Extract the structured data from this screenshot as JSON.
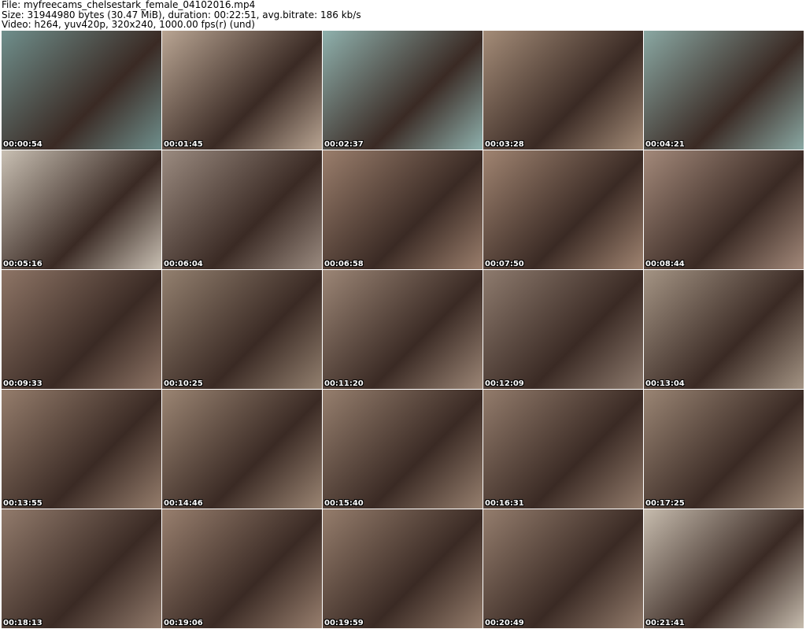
{
  "header": {
    "file": "File: myfreecams_chelsestark_female_04102016.mp4",
    "size": "Size: 31944980 bytes (30.47 MiB), duration: 00:22:51, avg.bitrate: 186 kb/s",
    "video": "Video: h264, yuv420p, 320x240, 1000.00 fps(r) (und)"
  },
  "thumbnails": [
    {
      "time": "00:00:54",
      "tone": "#6f8f8c"
    },
    {
      "time": "00:01:45",
      "tone": "#b9a593"
    },
    {
      "time": "00:02:37",
      "tone": "#8fb1ad"
    },
    {
      "time": "00:03:28",
      "tone": "#a48c78"
    },
    {
      "time": "00:04:21",
      "tone": "#8aa8a3"
    },
    {
      "time": "00:05:16",
      "tone": "#c9c0b3"
    },
    {
      "time": "00:06:04",
      "tone": "#9b8b80"
    },
    {
      "time": "00:06:58",
      "tone": "#9a7e6c"
    },
    {
      "time": "00:07:50",
      "tone": "#a08471"
    },
    {
      "time": "00:08:44",
      "tone": "#a3897a"
    },
    {
      "time": "00:09:33",
      "tone": "#8e7566"
    },
    {
      "time": "00:10:25",
      "tone": "#93806f"
    },
    {
      "time": "00:11:20",
      "tone": "#9c8676"
    },
    {
      "time": "00:12:09",
      "tone": "#8e7b6e"
    },
    {
      "time": "00:13:04",
      "tone": "#a49484"
    },
    {
      "time": "00:13:55",
      "tone": "#957d6c"
    },
    {
      "time": "00:14:46",
      "tone": "#9b8573"
    },
    {
      "time": "00:15:40",
      "tone": "#967f6e"
    },
    {
      "time": "00:16:31",
      "tone": "#937c6c"
    },
    {
      "time": "00:17:25",
      "tone": "#9a8574"
    },
    {
      "time": "00:18:13",
      "tone": "#927b6c"
    },
    {
      "time": "00:19:06",
      "tone": "#987f6e"
    },
    {
      "time": "00:19:59",
      "tone": "#957d6c"
    },
    {
      "time": "00:20:49",
      "tone": "#947d6d"
    },
    {
      "time": "00:21:41",
      "tone": "#c7bcae"
    }
  ]
}
